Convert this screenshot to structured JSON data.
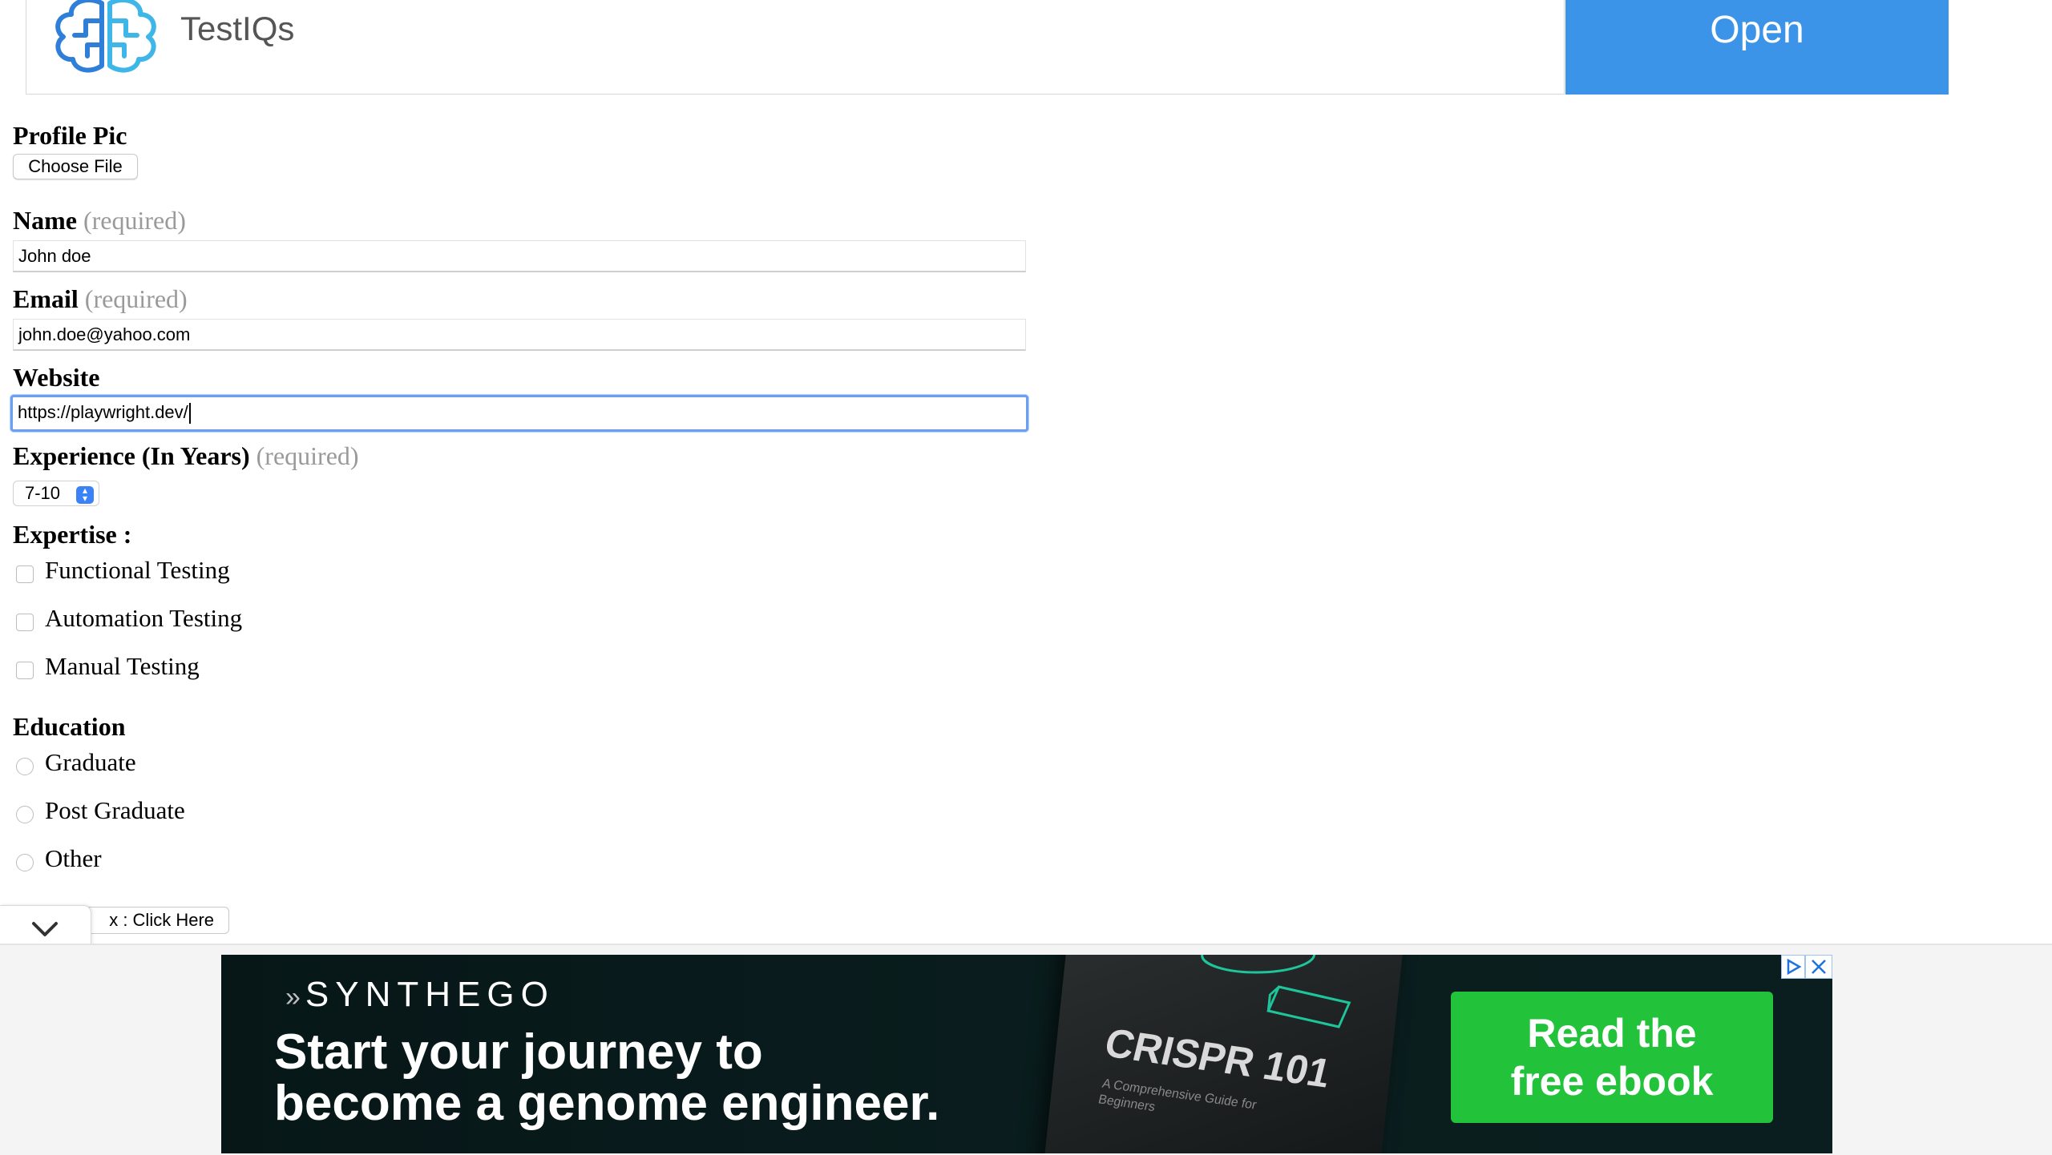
{
  "top_ad": {
    "brand": "TestIQs",
    "open_label": "Open",
    "open_color": "#3b94e8"
  },
  "form": {
    "profile_pic": {
      "label": "Profile Pic",
      "button": "Choose File"
    },
    "name": {
      "label": "Name",
      "required": "(required)",
      "value": "John doe"
    },
    "email": {
      "label": "Email",
      "required": "(required)",
      "value": "john.doe@yahoo.com"
    },
    "website": {
      "label": "Website",
      "value": "https://playwright.dev/"
    },
    "experience": {
      "label": "Experience (In Years)",
      "required": "(required)",
      "selected": "7-10"
    },
    "expertise": {
      "label": "Expertise :",
      "options": [
        "Functional Testing",
        "Automation Testing",
        "Manual Testing"
      ],
      "checked": [
        false,
        false,
        false
      ]
    },
    "education": {
      "label": "Education",
      "options": [
        "Graduate",
        "Post Graduate",
        "Other"
      ],
      "selected": null
    },
    "alert_button": "x : Click Here",
    "focus_color": "#6aa0ef"
  },
  "bottom_ad": {
    "brand": "SYNTHEGO",
    "headline_line1": "Start your journey to",
    "headline_line2": "become a genome engineer.",
    "book_title": "CRISPR 101",
    "book_subtitle": "A Comprehensive Guide for Beginners",
    "cta_line1": "Read the",
    "cta_line2": "free ebook",
    "cta_color": "#22c23a",
    "icons": [
      "adchoices-icon",
      "close-icon"
    ]
  }
}
